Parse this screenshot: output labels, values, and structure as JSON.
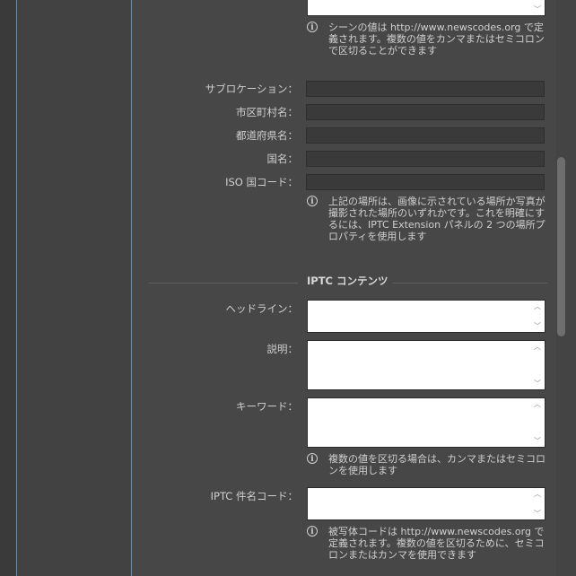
{
  "location": {
    "scene_note": "シーンの値は http://www.newscodes.org で定義されます。複数の値をカンマまたはセミコロンで区切ることができます",
    "fields": [
      {
        "label": "サブロケーション："
      },
      {
        "label": "市区町村名："
      },
      {
        "label": "都道府県名："
      },
      {
        "label": "国名："
      },
      {
        "label": "ISO 国コード："
      }
    ],
    "location_note": "上記の場所は、画像に示されている場所か写真が撮影された場所のいずれかです。これを明確にするには、IPTC Extension パネルの 2 つの場所プロパティを使用します"
  },
  "iptc_content": {
    "section_title": "IPTC コンテンツ",
    "headline_label": "ヘッドライン：",
    "description_label": "説明：",
    "keywords_label": "キーワード：",
    "keywords_note": "複数の値を区切る場合は、カンマまたはセミコロンを使用します",
    "subject_code_label": "IPTC 件名コード：",
    "subject_code_note": "被写体コードは http://www.newscodes.org で定義されます。複数の値を区切るために、セミコロンまたはカンマを使用できます"
  },
  "icons": {
    "info": "info-icon",
    "scroll_up": "chevron-up-icon",
    "scroll_down": "chevron-down-icon"
  }
}
